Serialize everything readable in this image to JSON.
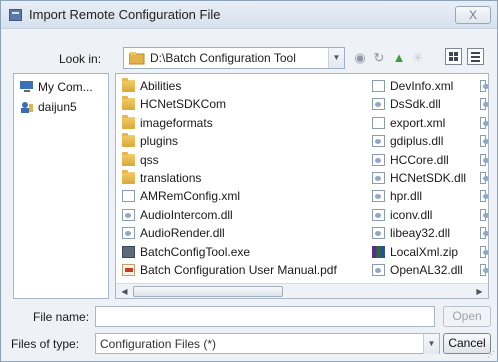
{
  "window": {
    "title": "Import Remote Configuration File",
    "close_label": "X"
  },
  "lookin": {
    "label": "Look in:",
    "path": "D:\\Batch Configuration Tool"
  },
  "toolbar": {
    "back_glyph": "◉",
    "forward_glyph": "↻",
    "up_glyph": "▲",
    "newfolder_glyph": "✳"
  },
  "sidebar": {
    "items": [
      {
        "label": "My Com...",
        "icon": "computer-icon"
      },
      {
        "label": "daijun5",
        "icon": "user-icon"
      }
    ]
  },
  "files": {
    "column1": [
      {
        "name": "Abilities",
        "type": "folder"
      },
      {
        "name": "HCNetSDKCom",
        "type": "folder"
      },
      {
        "name": "imageformats",
        "type": "folder"
      },
      {
        "name": "plugins",
        "type": "folder"
      },
      {
        "name": "qss",
        "type": "folder"
      },
      {
        "name": "translations",
        "type": "folder"
      },
      {
        "name": "AMRemConfig.xml",
        "type": "doc"
      },
      {
        "name": "AudioIntercom.dll",
        "type": "dll"
      },
      {
        "name": "AudioRender.dll",
        "type": "dll"
      },
      {
        "name": "BatchConfigTool.exe",
        "type": "exe"
      },
      {
        "name": "Batch Configuration User Manual.pdf",
        "type": "pdf"
      }
    ],
    "column2": [
      {
        "name": "DevInfo.xml",
        "type": "doc"
      },
      {
        "name": "DsSdk.dll",
        "type": "dll"
      },
      {
        "name": "export.xml",
        "type": "doc"
      },
      {
        "name": "gdiplus.dll",
        "type": "dll"
      },
      {
        "name": "HCCore.dll",
        "type": "dll"
      },
      {
        "name": "HCNetSDK.dll",
        "type": "dll"
      },
      {
        "name": "hpr.dll",
        "type": "dll"
      },
      {
        "name": "iconv.dll",
        "type": "dll"
      },
      {
        "name": "libeay32.dll",
        "type": "dll"
      },
      {
        "name": "LocalXml.zip",
        "type": "zip"
      },
      {
        "name": "OpenAL32.dll",
        "type": "dll"
      }
    ]
  },
  "scrollbar": {
    "left_glyph": "◀",
    "right_glyph": "▶"
  },
  "filename": {
    "label": "File name:",
    "value": "",
    "open_label": "Open"
  },
  "filetype": {
    "label": "Files of type:",
    "value": "Configuration Files (*)",
    "cancel_label": "Cancel"
  }
}
